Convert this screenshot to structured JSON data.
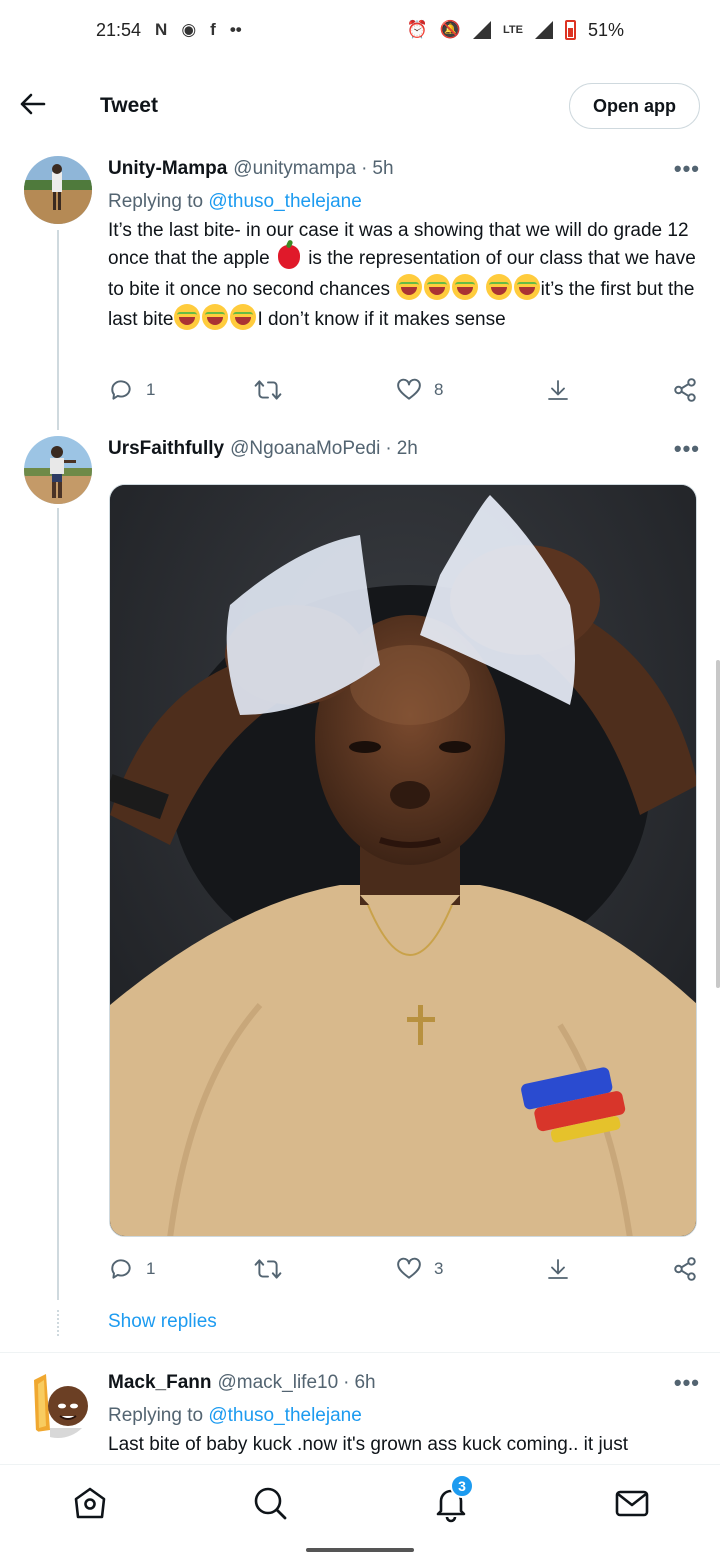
{
  "status_bar": {
    "time": "21:54",
    "battery": "51%",
    "network": "LTE"
  },
  "header": {
    "title": "Tweet",
    "open_app": "Open app"
  },
  "tweets": [
    {
      "name": "Unity-Mampa",
      "handle": "@unitymampa",
      "sep": "·",
      "time": "5h",
      "replying_label": "Replying to",
      "replying_to": "@thuso_thelejane",
      "text_1": "It’s the last bite- in our case it was a showing that we will do grade 12 once that the apple",
      "text_2": "is the representation of our class that we have to bite it once no second chances",
      "text_3": "it’s the first but the last bite",
      "text_4": "I don’t know if it makes sense",
      "replies": "1",
      "likes": "8"
    },
    {
      "name": "UrsFaithfully",
      "handle": "@NgoanaMoPedi",
      "sep": "·",
      "time": "2h",
      "replies": "1",
      "likes": "3"
    },
    {
      "name": "Mack_Fann",
      "handle": "@mack_life10",
      "sep": "·",
      "time": "6h",
      "replying_label": "Replying to",
      "replying_to": "@thuso_thelejane",
      "text": "Last bite of baby kuck .now it's grown ass kuck coming.. it just"
    }
  ],
  "show_replies": "Show replies",
  "nav": {
    "notifications_badge": "3"
  },
  "colors": {
    "accent": "#1d9bf0",
    "text": "#0f1419",
    "muted": "#536471"
  },
  "icons": [
    "back-arrow-icon",
    "more-icon",
    "reply-icon",
    "retweet-icon",
    "like-icon",
    "download-icon",
    "share-icon",
    "home-icon",
    "search-icon",
    "bell-icon",
    "mail-icon"
  ]
}
